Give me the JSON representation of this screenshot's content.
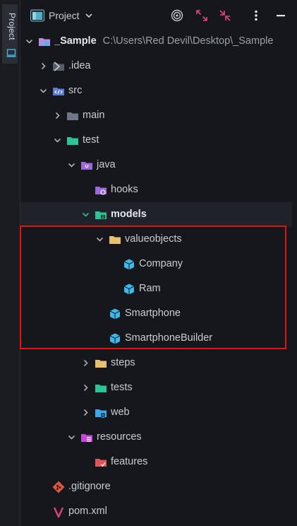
{
  "sidebar": {
    "tab_label": "Project",
    "tab_icon": "project-window-icon"
  },
  "header": {
    "view_label": "Project",
    "buttons": [
      "target-icon",
      "expand-all-icon",
      "collapse-all-icon",
      "more-options-icon",
      "hide-icon"
    ]
  },
  "tree": {
    "root": {
      "name": "_Sample",
      "path": "C:\\Users\\Red Devil\\Desktop\\_Sample"
    },
    "idea": ".idea",
    "src": "src",
    "main": "main",
    "test": "test",
    "java": "java",
    "hooks": "hooks",
    "models": "models",
    "valueobjects": "valueobjects",
    "company": "Company",
    "ram": "Ram",
    "smartphone": "Smartphone",
    "smartphone_builder": "SmartphoneBuilder",
    "steps": "steps",
    "tests": "tests",
    "web": "web",
    "resources": "resources",
    "features": "features",
    "gitignore": ".gitignore",
    "pom": "pom.xml"
  },
  "colors": {
    "background": "#15171c",
    "selected_row": "#1f2229",
    "highlight_border": "#e01414",
    "folder_gray": "#6f7787",
    "folder_green": "#29c497",
    "folder_purple": "#9b6ad8",
    "folder_yellow": "#e8c170",
    "class_icon": "#3fb8e8",
    "resources_folder": "#c44ad4",
    "features_folder": "#e05555"
  }
}
